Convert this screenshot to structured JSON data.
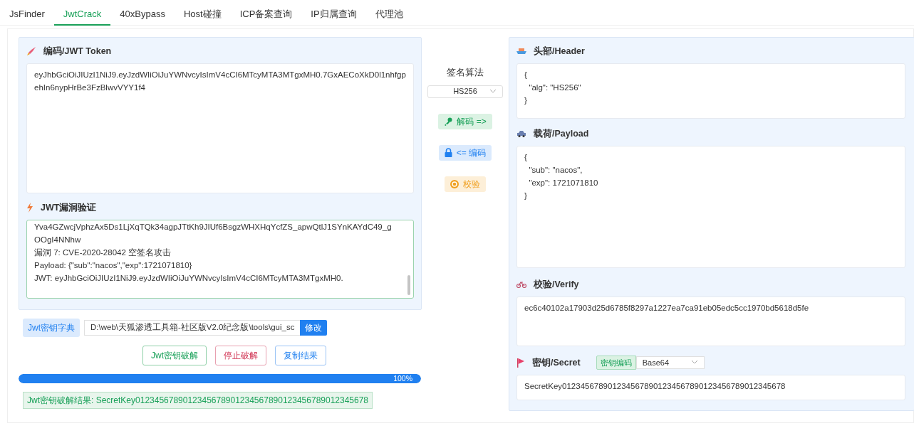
{
  "tabs": [
    {
      "label": "JsFinder",
      "selected": false
    },
    {
      "label": "JwtCrack",
      "selected": true
    },
    {
      "label": "40xBypass",
      "selected": false
    },
    {
      "label": "Host碰撞",
      "selected": false
    },
    {
      "label": "ICP备案查询",
      "selected": false
    },
    {
      "label": "IP归属查询",
      "selected": false
    },
    {
      "label": "代理池",
      "selected": false
    }
  ],
  "token_panel": {
    "title": "编码/JWT Token",
    "token": "eyJhbGciOiJIUzI1NiJ9.eyJzdWIiOiJuYWNvcyIsImV4cCI6MTcyMTA3MTgxMH0.7GxAECoXkD0l1nhfgpehIn6nypHrBe3FzBlwvVYY1f4"
  },
  "vuln_panel": {
    "title": "JWT漏洞验证",
    "lines": [
      "Yva4GZwcjVphzAx5Ds1LjXqTQk34agpJTtKh9JIUf6BsgzWHXHqYcfZS_apwQtlJ1SYnKAYdC49_gOOgI4NNhw",
      "漏洞 7: CVE-2020-28042 空签名攻击",
      "Payload: {\"sub\":\"nacos\",\"exp\":1721071810}",
      "JWT: eyJhbGciOiJIUzI1NiJ9.eyJzdWIiOiJuYWNvcyIsImV4cCI6MTcyMTA3MTgxMH0."
    ]
  },
  "dictionary": {
    "label": "Jwt密钥字典",
    "path": "D:\\web\\天狐渗透工具箱-社区版V2.0纪念版\\tools\\gui_sc",
    "button": "修改"
  },
  "actions": [
    {
      "label": "Jwt密钥破解",
      "kind": "success"
    },
    {
      "label": "停止破解",
      "kind": "danger"
    },
    {
      "label": "复制结果",
      "kind": "primary"
    }
  ],
  "progress": {
    "level": 1,
    "reading": "100%"
  },
  "result": "Jwt密钥破解结果: SecretKey0123456789012345678901234567890123456789012345678",
  "algorithm": {
    "label": "签名算法",
    "value": "HS256"
  },
  "middle_buttons": [
    {
      "label": "解码 =>",
      "kind": "decode"
    },
    {
      "label": "<= 编码",
      "kind": "encode"
    },
    {
      "label": "校验",
      "kind": "verify"
    }
  ],
  "header": {
    "title": "头部/Header",
    "text": "{\n  \"alg\": \"HS256\"\n}"
  },
  "payload": {
    "title": "载荷/Payload",
    "text": "{\n  \"sub\": \"nacos\",\n  \"exp\": 1721071810\n}"
  },
  "verify": {
    "title": "校验/Verify",
    "text": "ec6c40102a17903d25d6785f8297a1227ea7ca91eb05edc5cc1970bd5618d5fe"
  },
  "secret": {
    "title": "密钥/Secret",
    "encoding_label": "密钥编码",
    "encoding": "Base64",
    "value": "SecretKey0123456789012345678901234567890123456789012345678"
  }
}
